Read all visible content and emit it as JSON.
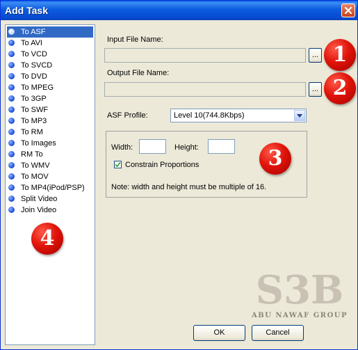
{
  "window": {
    "title": "Add Task"
  },
  "formats": [
    {
      "label": "To ASF",
      "selected": true
    },
    {
      "label": "To AVI"
    },
    {
      "label": "To VCD"
    },
    {
      "label": "To SVCD"
    },
    {
      "label": "To DVD"
    },
    {
      "label": "To MPEG"
    },
    {
      "label": "To 3GP"
    },
    {
      "label": "To SWF"
    },
    {
      "label": "To MP3"
    },
    {
      "label": "To RM"
    },
    {
      "label": "To Images"
    },
    {
      "label": "RM To"
    },
    {
      "label": "To WMV"
    },
    {
      "label": "To MOV"
    },
    {
      "label": "To MP4(iPod/PSP)"
    },
    {
      "label": "Split Video"
    },
    {
      "label": "Join Video"
    }
  ],
  "input": {
    "label": "Input File Name:",
    "value": "",
    "browse": "..."
  },
  "output": {
    "label": "Output File Name:",
    "value": "",
    "browse": "..."
  },
  "profile": {
    "label": "ASF Profile:",
    "value": "Level 10(744.8Kbps)"
  },
  "size": {
    "width_label": "Width:",
    "width_value": "",
    "height_label": "Height:",
    "height_value": "",
    "constrain_label": "Constrain Proportions",
    "constrain_checked": true,
    "note": "Note: width and height must be multiple of 16."
  },
  "buttons": {
    "ok": "OK",
    "cancel": "Cancel"
  },
  "badges": [
    "1",
    "2",
    "3",
    "4"
  ],
  "watermark": {
    "logo": "S3B",
    "tagline": "ABU NAWAF GROUP"
  },
  "colors": {
    "titlebar": "#0a5fe8",
    "selection": "#316ac5",
    "badge": "#e0140a",
    "window_bg": "#ece9d8"
  }
}
